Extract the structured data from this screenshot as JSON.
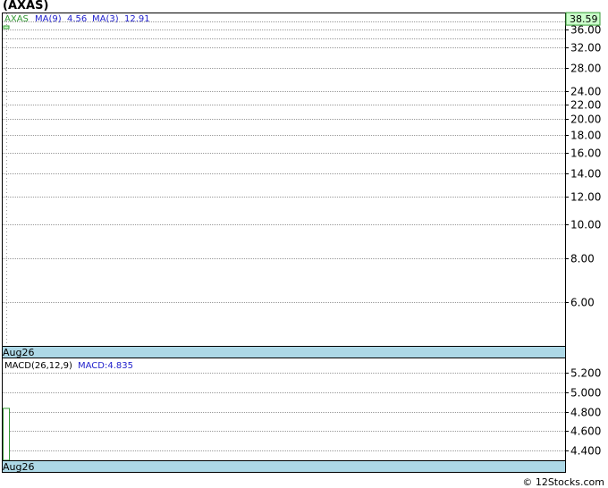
{
  "title": "(AXAS)",
  "legend": {
    "ticker": "AXAS",
    "ma9_label": "MA(9)",
    "ma9_value": "4.56",
    "ma3_label": "MA(3)",
    "ma3_value": "12.91"
  },
  "price_panel": {
    "last_price": "38.59",
    "date_label": "Aug26"
  },
  "macd_panel": {
    "label": "MACD(26,12,9)",
    "value_label": "MACD:4.835",
    "date_label": "Aug26"
  },
  "credit": "© 12Stocks.com",
  "colors": {
    "price_line": "#339933",
    "legend_blue": "#2222cc",
    "axis_band": "#add8e6",
    "last_price_box": "#ccffcc",
    "grid": "#999999"
  },
  "chart_data": [
    {
      "type": "line",
      "scale": "log",
      "ylim": [
        4.5,
        40
      ],
      "yticks": [
        6.0,
        8.0,
        10.0,
        12.0,
        14.0,
        16.0,
        18.0,
        20.0,
        22.0,
        24.0,
        28.0,
        32.0,
        36.0
      ],
      "ytick_labels": [
        "6.00",
        "8.00",
        "10.00",
        "12.00",
        "14.00",
        "16.00",
        "18.00",
        "20.00",
        "22.00",
        "24.00",
        "28.00",
        "32.00",
        "36.00"
      ],
      "x": [
        "Aug26"
      ],
      "series": [
        {
          "name": "AXAS",
          "values": [
            38.59
          ]
        }
      ]
    },
    {
      "type": "bar",
      "ylim": [
        4.3,
        5.35
      ],
      "yticks": [
        4.4,
        4.6,
        4.8,
        5.0,
        5.2
      ],
      "ytick_labels": [
        "4.400",
        "4.600",
        "4.800",
        "5.000",
        "5.200"
      ],
      "x": [
        "Aug26"
      ],
      "series": [
        {
          "name": "MACD",
          "values": [
            4.835
          ]
        }
      ]
    }
  ]
}
